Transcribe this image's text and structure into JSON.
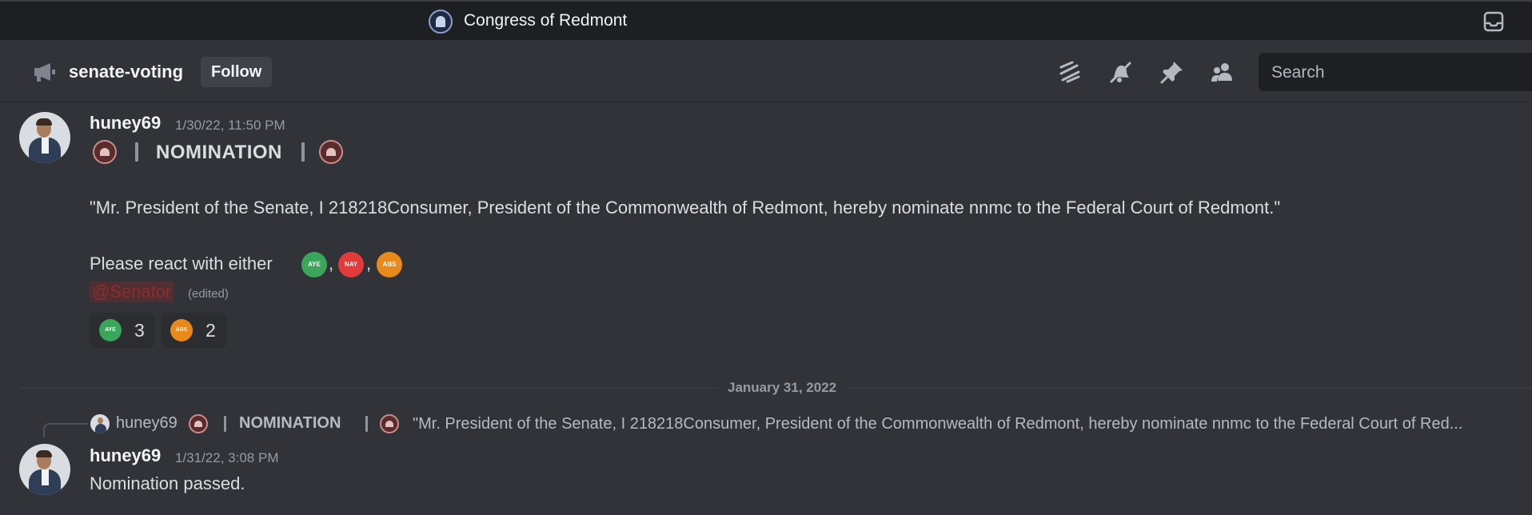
{
  "server": {
    "title": "Congress of Redmont",
    "icon": "capitol-seal-icon"
  },
  "channel": {
    "name": "senate-voting",
    "type_icon": "megaphone-icon",
    "follow_label": "Follow"
  },
  "toolbar": {
    "icons": [
      "threads-icon",
      "mute-bell-icon",
      "pin-icon",
      "members-icon",
      "inbox-icon"
    ],
    "search_placeholder": "Search"
  },
  "messages": [
    {
      "username": "huney69",
      "timestamp": "1/30/22, 11:50 PM",
      "header": "NOMINATION",
      "body": "\"Mr. President of the Senate, I 218218Consumer, President of the Commonwealth of Redmont, hereby nominate nnmc to the Federal Court of Redmont.\"",
      "prompt": "Please react with either",
      "vote_emojis": [
        "AYE",
        "NAY",
        "ABS"
      ],
      "mention": "@Senator",
      "edited": "(edited)",
      "reactions": [
        {
          "emoji": "AYE",
          "count": "3"
        },
        {
          "emoji": "ABS",
          "count": "2"
        }
      ]
    },
    {
      "username": "huney69",
      "timestamp": "1/31/22, 3:08 PM",
      "body": "Nomination passed.",
      "reply": {
        "username": "huney69",
        "header": "NOMINATION",
        "quote": "\"Mr. President of the Senate, I 218218Consumer, President of the Commonwealth of Redmont, hereby nominate nnmc to the Federal Court of Red..."
      }
    }
  ],
  "date_divider": "January 31, 2022",
  "colors": {
    "background": "#313338",
    "titlebar": "#1e1f22",
    "aye": "#3ba55c",
    "nay": "#e23b3b",
    "abs": "#e8891c",
    "mention": "#8f2b2b"
  }
}
